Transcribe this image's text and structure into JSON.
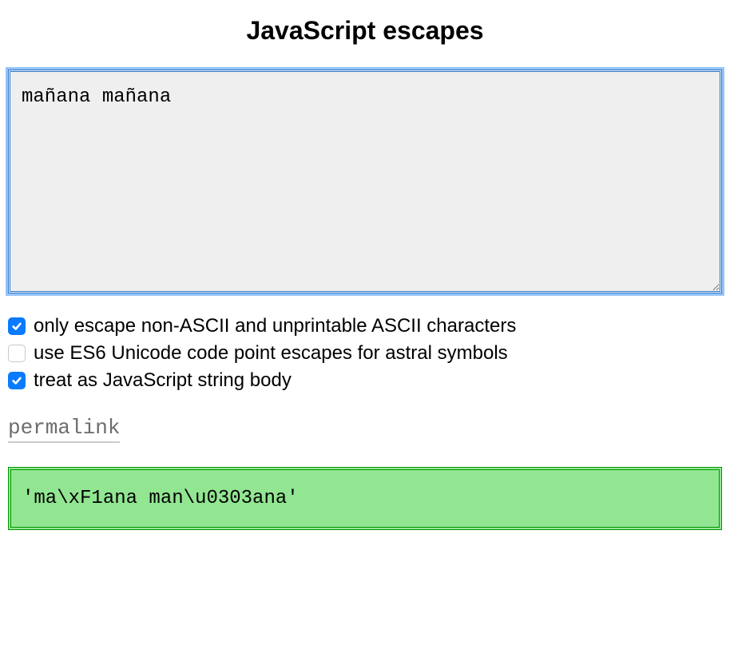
{
  "title": "JavaScript escapes",
  "input": {
    "value": "mañana mañana"
  },
  "options": [
    {
      "label": "only escape non-ASCII and unprintable ASCII characters",
      "checked": true
    },
    {
      "label": "use ES6 Unicode code point escapes for astral symbols",
      "checked": false
    },
    {
      "label": "treat as JavaScript string body",
      "checked": true
    }
  ],
  "permalink": "permalink",
  "output": "'ma\\xF1ana man\\u0303ana'"
}
